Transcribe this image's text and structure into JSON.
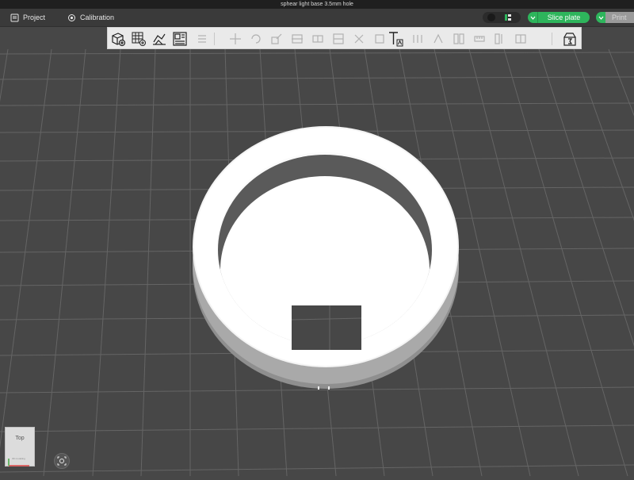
{
  "window": {
    "title": "sphear light base 3.5mm hole"
  },
  "menu": {
    "project_label": "Project",
    "calibration_label": "Calibration",
    "slice_label": "Slice plate",
    "print_label": "Print"
  },
  "toolbar": {
    "tools": [
      {
        "icon": "add-cube-icon",
        "enabled": true
      },
      {
        "icon": "add-plate-icon",
        "enabled": true
      },
      {
        "icon": "auto-orient-icon",
        "enabled": true
      },
      {
        "icon": "arrange-icon",
        "enabled": true
      },
      {
        "icon": "split-objects-icon",
        "enabled": false
      },
      {
        "icon": "move-icon",
        "enabled": false
      },
      {
        "icon": "rotate-icon",
        "enabled": false
      },
      {
        "icon": "scale-icon",
        "enabled": false
      },
      {
        "icon": "cut-icon",
        "enabled": false
      },
      {
        "icon": "lay-on-face-icon",
        "enabled": false
      },
      {
        "icon": "text-tool-icon",
        "enabled": true
      },
      {
        "icon": "support-paint-icon",
        "enabled": false
      },
      {
        "icon": "seam-paint-icon",
        "enabled": false
      },
      {
        "icon": "color-paint-icon",
        "enabled": false
      },
      {
        "icon": "measure-icon",
        "enabled": false
      },
      {
        "icon": "assembly-view-icon",
        "enabled": true
      }
    ]
  },
  "view_cube": {
    "face": "Top",
    "sublabel": "3D modeling"
  },
  "colors": {
    "accent": "#2eb55c",
    "background": "#474747",
    "toolbar": "#eaeaea",
    "grid_line": "#646464",
    "model": "#ffffff"
  }
}
